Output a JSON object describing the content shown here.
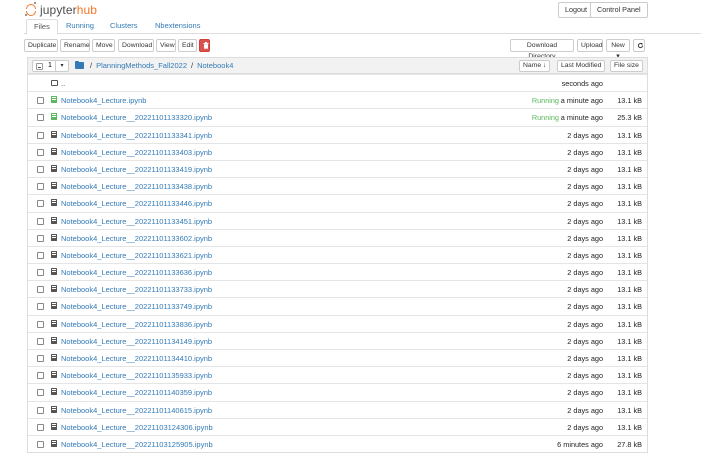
{
  "header": {
    "logo_left": "jupyter",
    "logo_right": "hub",
    "logout_label": "Logout",
    "control_panel_label": "Control Panel"
  },
  "tabs": [
    {
      "label": "Files",
      "active": true
    },
    {
      "label": "Running",
      "active": false
    },
    {
      "label": "Clusters",
      "active": false
    },
    {
      "label": "Nbextensions",
      "active": false
    }
  ],
  "toolbar": {
    "duplicate": "Duplicate",
    "rename": "Rename",
    "move": "Move",
    "download": "Download",
    "view": "View",
    "edit": "Edit",
    "download_directory": "Download Directory",
    "upload": "Upload",
    "new": "New ▾",
    "refresh_icon": "refresh-icon",
    "delete_icon": "trash-icon"
  },
  "list_header": {
    "selected_count": "1",
    "breadcrumb": [
      "PlanningMethods_Fall2022",
      "Notebook4"
    ],
    "sort_name": "Name ↓",
    "last_modified": "Last Modified",
    "file_size": "File size"
  },
  "rows": [
    {
      "type": "folder",
      "name": "..",
      "status": "",
      "modified": "seconds ago",
      "size": ""
    },
    {
      "type": "running",
      "name": "Notebook4_Lecture.ipynb",
      "status": "Running",
      "modified": "a minute ago",
      "size": "13.1 kB"
    },
    {
      "type": "running",
      "name": "Notebook4_Lecture__20221101133320.ipynb",
      "status": "Running",
      "modified": "a minute ago",
      "size": "25.3 kB"
    },
    {
      "type": "nb",
      "name": "Notebook4_Lecture__20221101133341.ipynb",
      "status": "",
      "modified": "2 days ago",
      "size": "13.1 kB"
    },
    {
      "type": "nb",
      "name": "Notebook4_Lecture__20221101133403.ipynb",
      "status": "",
      "modified": "2 days ago",
      "size": "13.1 kB"
    },
    {
      "type": "nb",
      "name": "Notebook4_Lecture__20221101133419.ipynb",
      "status": "",
      "modified": "2 days ago",
      "size": "13.1 kB"
    },
    {
      "type": "nb",
      "name": "Notebook4_Lecture__20221101133438.ipynb",
      "status": "",
      "modified": "2 days ago",
      "size": "13.1 kB"
    },
    {
      "type": "nb",
      "name": "Notebook4_Lecture__20221101133446.ipynb",
      "status": "",
      "modified": "2 days ago",
      "size": "13.1 kB"
    },
    {
      "type": "nb",
      "name": "Notebook4_Lecture__20221101133451.ipynb",
      "status": "",
      "modified": "2 days ago",
      "size": "13.1 kB"
    },
    {
      "type": "nb",
      "name": "Notebook4_Lecture__20221101133602.ipynb",
      "status": "",
      "modified": "2 days ago",
      "size": "13.1 kB"
    },
    {
      "type": "nb",
      "name": "Notebook4_Lecture__20221101133621.ipynb",
      "status": "",
      "modified": "2 days ago",
      "size": "13.1 kB"
    },
    {
      "type": "nb",
      "name": "Notebook4_Lecture__20221101133636.ipynb",
      "status": "",
      "modified": "2 days ago",
      "size": "13.1 kB"
    },
    {
      "type": "nb",
      "name": "Notebook4_Lecture__20221101133733.ipynb",
      "status": "",
      "modified": "2 days ago",
      "size": "13.1 kB"
    },
    {
      "type": "nb",
      "name": "Notebook4_Lecture__20221101133749.ipynb",
      "status": "",
      "modified": "2 days ago",
      "size": "13.1 kB"
    },
    {
      "type": "nb",
      "name": "Notebook4_Lecture__20221101133836.ipynb",
      "status": "",
      "modified": "2 days ago",
      "size": "13.1 kB"
    },
    {
      "type": "nb",
      "name": "Notebook4_Lecture__20221101134149.ipynb",
      "status": "",
      "modified": "2 days ago",
      "size": "13.1 kB"
    },
    {
      "type": "nb",
      "name": "Notebook4_Lecture__20221101134410.ipynb",
      "status": "",
      "modified": "2 days ago",
      "size": "13.1 kB"
    },
    {
      "type": "nb",
      "name": "Notebook4_Lecture__20221101135933.ipynb",
      "status": "",
      "modified": "2 days ago",
      "size": "13.1 kB"
    },
    {
      "type": "nb",
      "name": "Notebook4_Lecture__20221101140359.ipynb",
      "status": "",
      "modified": "2 days ago",
      "size": "13.1 kB"
    },
    {
      "type": "nb",
      "name": "Notebook4_Lecture__20221101140615.ipynb",
      "status": "",
      "modified": "2 days ago",
      "size": "13.1 kB"
    },
    {
      "type": "nb",
      "name": "Notebook4_Lecture__20221103124306.ipynb",
      "status": "",
      "modified": "2 days ago",
      "size": "13.1 kB"
    },
    {
      "type": "nb",
      "name": "Notebook4_Lecture__20221103125905.ipynb",
      "status": "",
      "modified": "6 minutes ago",
      "size": "27.8 kB"
    }
  ]
}
